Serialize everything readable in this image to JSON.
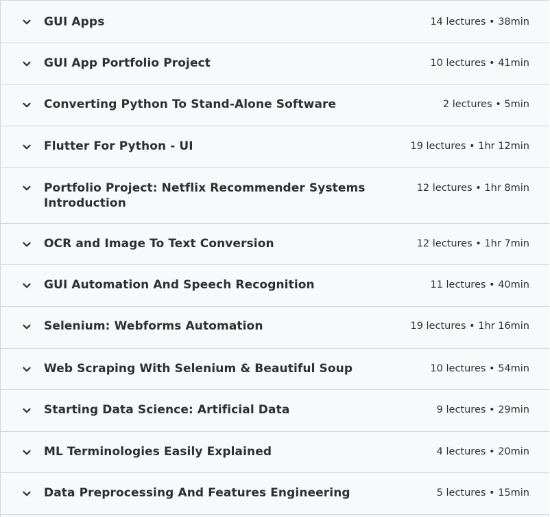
{
  "sections": [
    {
      "title": "GUI Apps",
      "meta": "14 lectures • 38min"
    },
    {
      "title": "GUI App Portfolio Project",
      "meta": "10 lectures • 41min"
    },
    {
      "title": "Converting Python To Stand-Alone Software",
      "meta": "2 lectures • 5min"
    },
    {
      "title": "Flutter For Python - UI",
      "meta": "19 lectures • 1hr 12min"
    },
    {
      "title": "Portfolio Project: Netflix Recommender Systems Introduction",
      "meta": "12 lectures • 1hr 8min"
    },
    {
      "title": "OCR and Image To Text Conversion",
      "meta": "12 lectures • 1hr 7min"
    },
    {
      "title": "GUI Automation And Speech Recognition",
      "meta": "11 lectures • 40min"
    },
    {
      "title": "Selenium: Webforms Automation",
      "meta": "19 lectures • 1hr 16min"
    },
    {
      "title": "Web Scraping With Selenium & Beautiful Soup",
      "meta": "10 lectures • 54min"
    },
    {
      "title": "Starting Data Science: Artificial Data",
      "meta": "9 lectures • 29min"
    },
    {
      "title": "ML Terminologies Easily Explained",
      "meta": "4 lectures • 20min"
    },
    {
      "title": "Data Preprocessing And Features Engineering",
      "meta": "5 lectures • 15min"
    }
  ],
  "icons": {
    "expand": "chevron-down-icon"
  }
}
